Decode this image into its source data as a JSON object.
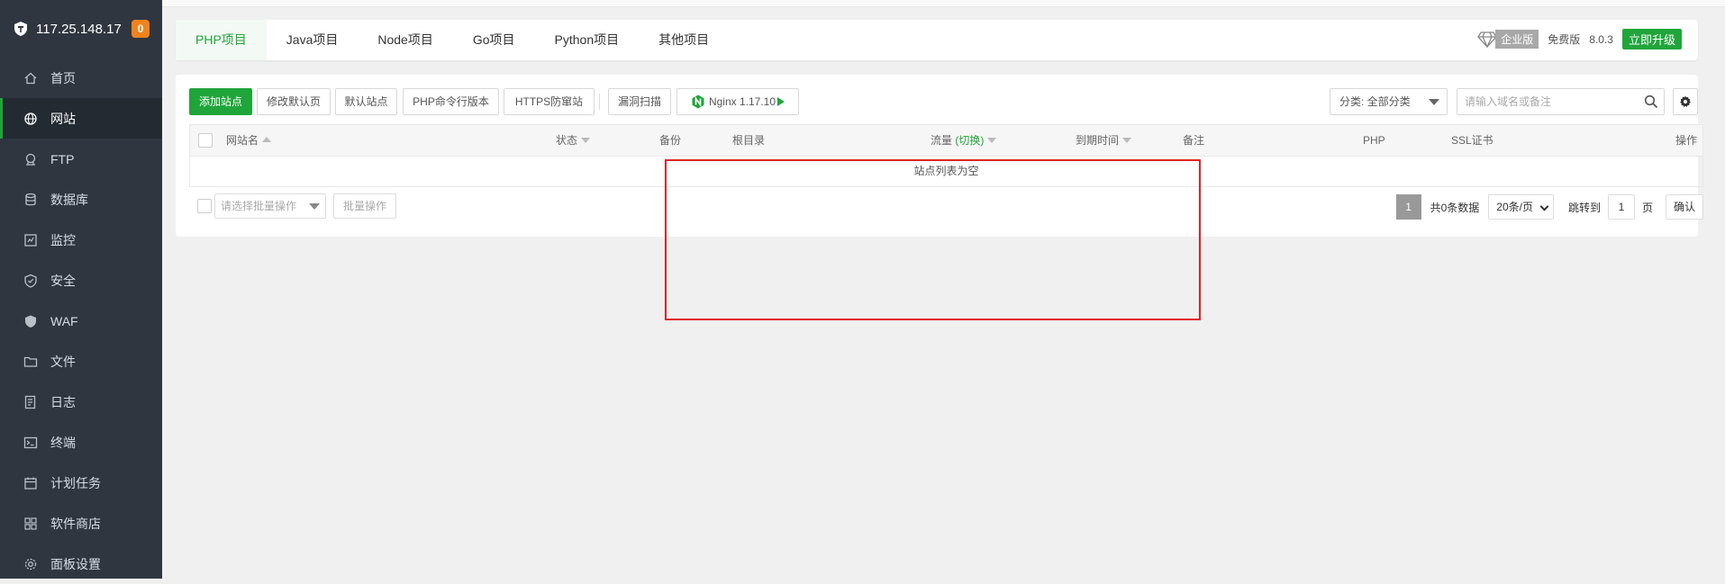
{
  "sidebar": {
    "ip": "117.25.148.17",
    "badge": "0",
    "items": [
      {
        "label": "首页",
        "icon": "home-icon"
      },
      {
        "label": "网站",
        "icon": "globe-icon"
      },
      {
        "label": "FTP",
        "icon": "ftp-icon"
      },
      {
        "label": "数据库",
        "icon": "database-icon"
      },
      {
        "label": "监控",
        "icon": "monitor-icon"
      },
      {
        "label": "安全",
        "icon": "shield-check-icon"
      },
      {
        "label": "WAF",
        "icon": "waf-shield-icon"
      },
      {
        "label": "文件",
        "icon": "folder-icon"
      },
      {
        "label": "日志",
        "icon": "log-icon"
      },
      {
        "label": "终端",
        "icon": "terminal-icon"
      },
      {
        "label": "计划任务",
        "icon": "calendar-icon"
      },
      {
        "label": "软件商店",
        "icon": "apps-grid-icon"
      },
      {
        "label": "面板设置",
        "icon": "gear-icon"
      }
    ],
    "active_index": 1
  },
  "tabs": {
    "items": [
      "PHP项目",
      "Java项目",
      "Node项目",
      "Go项目",
      "Python项目",
      "其他项目"
    ],
    "active_index": 0
  },
  "header_right": {
    "enterprise": "企业版",
    "free": "免费版",
    "version": "8.0.3",
    "upgrade": "立即升级"
  },
  "toolbar": {
    "add_site": "添加站点",
    "modify_default_page": "修改默认页",
    "default_site": "默认站点",
    "php_cli_version": "PHP命令行版本",
    "https_antiblock": "HTTPS防窜站",
    "vuln_scan": "漏洞扫描",
    "nginx": "Nginx 1.17.10",
    "category_select": "分类: 全部分类",
    "search_placeholder": "请输入域名或备注"
  },
  "table": {
    "columns": {
      "site_name": "网站名",
      "status": "状态",
      "backup": "备份",
      "root": "根目录",
      "traffic": "流量",
      "traffic_switch": "(切换)",
      "expire": "到期时间",
      "remark": "备注",
      "php": "PHP",
      "ssl": "SSL证书",
      "actions": "操作"
    },
    "empty_text": "站点列表为空"
  },
  "footer": {
    "batch_placeholder": "请选择批量操作",
    "batch_button": "批量操作",
    "current_page": "1",
    "total": "共0条数据",
    "page_size": "20条/页",
    "jump_label": "跳转到",
    "jump_value": "1",
    "page_unit": "页",
    "confirm": "确认"
  },
  "colors": {
    "accent": "#20a53a",
    "sidebar_bg": "#2f3640",
    "badge": "#f0831e",
    "highlight": "#e02424"
  }
}
